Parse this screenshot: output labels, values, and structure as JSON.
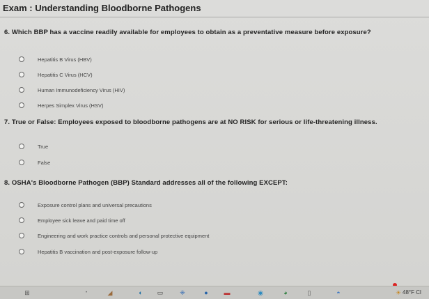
{
  "exam": {
    "title": "Exam : Understanding Bloodborne Pathogens"
  },
  "questions": [
    {
      "prompt": "6. Which BBP has a vaccine readily available for employees to obtain as a preventative measure before exposure?",
      "options": [
        "Hepatitis B Virus (HBV)",
        "Hepatitis C Virus (HCV)",
        "Human Immunodeficiency Virus (HIV)",
        "Herpes Simplex Virus (HSV)"
      ]
    },
    {
      "prompt": "7. True or False: Employees exposed to bloodborne pathogens are at NO RISK for serious or life-threatening illness.",
      "options": [
        "True",
        "False"
      ]
    },
    {
      "prompt": "8. OSHA's Bloodborne Pathogen (BBP) Standard addresses all of the following EXCEPT:",
      "options": [
        "Exposure control plans and universal precautions",
        "Employee sick leave and paid time off",
        "Engineering and work practice controls and personal protective equipment",
        "Hepatitis B vaccination and post-exposure follow-up"
      ]
    }
  ],
  "taskbar": {
    "weather": "48°F Cl",
    "icons": [
      "start-icon",
      "search-icon",
      "widget-icon",
      "edge-icon",
      "mail-icon",
      "apps-icon",
      "teams-icon",
      "news-icon",
      "chrome-icon",
      "green-app-icon",
      "phone-icon",
      "notes-icon",
      "sun-icon"
    ]
  }
}
